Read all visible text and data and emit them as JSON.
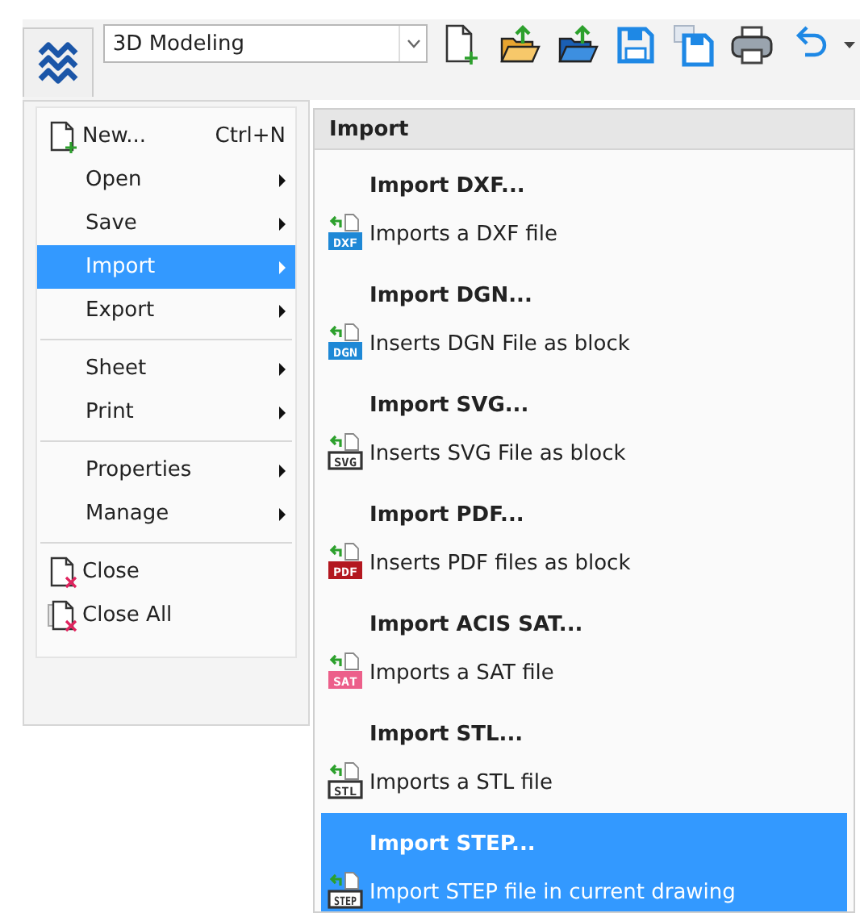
{
  "toolbar": {
    "workspace": "3D Modeling",
    "buttons": [
      {
        "kind": "new"
      },
      {
        "kind": "open-orange"
      },
      {
        "kind": "open-blue"
      },
      {
        "kind": "save"
      },
      {
        "kind": "save-as"
      },
      {
        "kind": "print"
      },
      {
        "kind": "undo"
      }
    ]
  },
  "menu": {
    "groups": [
      [
        {
          "label": "New...",
          "shortcut": "Ctrl+N",
          "kind": "new",
          "has_submenu": false,
          "selected": false
        },
        {
          "label": "Open",
          "has_submenu": true,
          "selected": false
        },
        {
          "label": "Save",
          "has_submenu": true,
          "selected": false
        },
        {
          "label": "Import",
          "has_submenu": true,
          "selected": true
        },
        {
          "label": "Export",
          "has_submenu": true,
          "selected": false
        }
      ],
      [
        {
          "label": "Sheet",
          "has_submenu": true,
          "selected": false
        },
        {
          "label": "Print",
          "has_submenu": true,
          "selected": false
        }
      ],
      [
        {
          "label": "Properties",
          "has_submenu": true,
          "selected": false
        },
        {
          "label": "Manage",
          "has_submenu": true,
          "selected": false
        }
      ],
      [
        {
          "label": "Close",
          "kind": "close",
          "has_submenu": false,
          "selected": false
        },
        {
          "label": "Close All",
          "kind": "close-all",
          "has_submenu": false,
          "selected": false
        }
      ]
    ]
  },
  "submenu": {
    "title": "Import",
    "items": [
      {
        "title": "Import DXF...",
        "description": "Imports a DXF file",
        "badge": "DXF",
        "kind": "filled",
        "color": "#1e88d6",
        "selected": false
      },
      {
        "title": "Import DGN...",
        "description": "Inserts DGN File as block",
        "badge": "DGN",
        "kind": "filled",
        "color": "#1e88d6",
        "selected": false
      },
      {
        "title": "Import SVG...",
        "description": "Inserts SVG File as block",
        "badge": "SVG",
        "kind": "outline",
        "color": "#333333",
        "selected": false
      },
      {
        "title": "Import PDF...",
        "description": "Inserts PDF files as block",
        "badge": "PDF",
        "kind": "filled",
        "color": "#b3171f",
        "selected": false
      },
      {
        "title": "Import ACIS SAT...",
        "description": "Imports a SAT file",
        "badge": "SAT",
        "kind": "filled",
        "color": "#ec5f8a",
        "selected": false
      },
      {
        "title": "Import STL...",
        "description": "Imports a STL file",
        "badge": "STL",
        "kind": "outline",
        "color": "#333333",
        "selected": false
      },
      {
        "title": "Import STEP...",
        "description": "Import STEP file in current drawing",
        "badge": "STEP",
        "kind": "outline",
        "color": "#333333",
        "selected": true
      }
    ]
  }
}
